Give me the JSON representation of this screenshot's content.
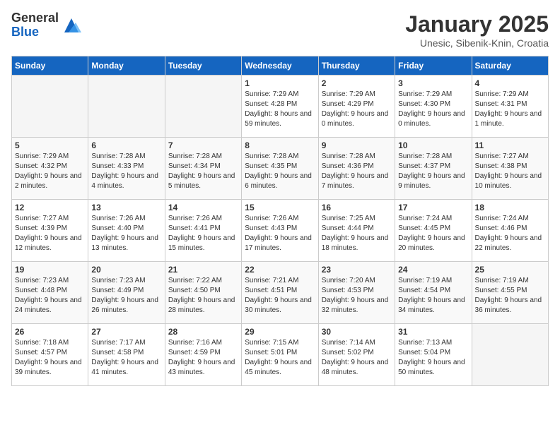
{
  "logo": {
    "general": "General",
    "blue": "Blue"
  },
  "title": {
    "month": "January 2025",
    "location": "Unesic, Sibenik-Knin, Croatia"
  },
  "weekdays": [
    "Sunday",
    "Monday",
    "Tuesday",
    "Wednesday",
    "Thursday",
    "Friday",
    "Saturday"
  ],
  "weeks": [
    [
      {
        "day": "",
        "content": ""
      },
      {
        "day": "",
        "content": ""
      },
      {
        "day": "",
        "content": ""
      },
      {
        "day": "1",
        "content": "Sunrise: 7:29 AM\nSunset: 4:28 PM\nDaylight: 8 hours and 59 minutes."
      },
      {
        "day": "2",
        "content": "Sunrise: 7:29 AM\nSunset: 4:29 PM\nDaylight: 9 hours and 0 minutes."
      },
      {
        "day": "3",
        "content": "Sunrise: 7:29 AM\nSunset: 4:30 PM\nDaylight: 9 hours and 0 minutes."
      },
      {
        "day": "4",
        "content": "Sunrise: 7:29 AM\nSunset: 4:31 PM\nDaylight: 9 hours and 1 minute."
      }
    ],
    [
      {
        "day": "5",
        "content": "Sunrise: 7:29 AM\nSunset: 4:32 PM\nDaylight: 9 hours and 2 minutes."
      },
      {
        "day": "6",
        "content": "Sunrise: 7:28 AM\nSunset: 4:33 PM\nDaylight: 9 hours and 4 minutes."
      },
      {
        "day": "7",
        "content": "Sunrise: 7:28 AM\nSunset: 4:34 PM\nDaylight: 9 hours and 5 minutes."
      },
      {
        "day": "8",
        "content": "Sunrise: 7:28 AM\nSunset: 4:35 PM\nDaylight: 9 hours and 6 minutes."
      },
      {
        "day": "9",
        "content": "Sunrise: 7:28 AM\nSunset: 4:36 PM\nDaylight: 9 hours and 7 minutes."
      },
      {
        "day": "10",
        "content": "Sunrise: 7:28 AM\nSunset: 4:37 PM\nDaylight: 9 hours and 9 minutes."
      },
      {
        "day": "11",
        "content": "Sunrise: 7:27 AM\nSunset: 4:38 PM\nDaylight: 9 hours and 10 minutes."
      }
    ],
    [
      {
        "day": "12",
        "content": "Sunrise: 7:27 AM\nSunset: 4:39 PM\nDaylight: 9 hours and 12 minutes."
      },
      {
        "day": "13",
        "content": "Sunrise: 7:26 AM\nSunset: 4:40 PM\nDaylight: 9 hours and 13 minutes."
      },
      {
        "day": "14",
        "content": "Sunrise: 7:26 AM\nSunset: 4:41 PM\nDaylight: 9 hours and 15 minutes."
      },
      {
        "day": "15",
        "content": "Sunrise: 7:26 AM\nSunset: 4:43 PM\nDaylight: 9 hours and 17 minutes."
      },
      {
        "day": "16",
        "content": "Sunrise: 7:25 AM\nSunset: 4:44 PM\nDaylight: 9 hours and 18 minutes."
      },
      {
        "day": "17",
        "content": "Sunrise: 7:24 AM\nSunset: 4:45 PM\nDaylight: 9 hours and 20 minutes."
      },
      {
        "day": "18",
        "content": "Sunrise: 7:24 AM\nSunset: 4:46 PM\nDaylight: 9 hours and 22 minutes."
      }
    ],
    [
      {
        "day": "19",
        "content": "Sunrise: 7:23 AM\nSunset: 4:48 PM\nDaylight: 9 hours and 24 minutes."
      },
      {
        "day": "20",
        "content": "Sunrise: 7:23 AM\nSunset: 4:49 PM\nDaylight: 9 hours and 26 minutes."
      },
      {
        "day": "21",
        "content": "Sunrise: 7:22 AM\nSunset: 4:50 PM\nDaylight: 9 hours and 28 minutes."
      },
      {
        "day": "22",
        "content": "Sunrise: 7:21 AM\nSunset: 4:51 PM\nDaylight: 9 hours and 30 minutes."
      },
      {
        "day": "23",
        "content": "Sunrise: 7:20 AM\nSunset: 4:53 PM\nDaylight: 9 hours and 32 minutes."
      },
      {
        "day": "24",
        "content": "Sunrise: 7:19 AM\nSunset: 4:54 PM\nDaylight: 9 hours and 34 minutes."
      },
      {
        "day": "25",
        "content": "Sunrise: 7:19 AM\nSunset: 4:55 PM\nDaylight: 9 hours and 36 minutes."
      }
    ],
    [
      {
        "day": "26",
        "content": "Sunrise: 7:18 AM\nSunset: 4:57 PM\nDaylight: 9 hours and 39 minutes."
      },
      {
        "day": "27",
        "content": "Sunrise: 7:17 AM\nSunset: 4:58 PM\nDaylight: 9 hours and 41 minutes."
      },
      {
        "day": "28",
        "content": "Sunrise: 7:16 AM\nSunset: 4:59 PM\nDaylight: 9 hours and 43 minutes."
      },
      {
        "day": "29",
        "content": "Sunrise: 7:15 AM\nSunset: 5:01 PM\nDaylight: 9 hours and 45 minutes."
      },
      {
        "day": "30",
        "content": "Sunrise: 7:14 AM\nSunset: 5:02 PM\nDaylight: 9 hours and 48 minutes."
      },
      {
        "day": "31",
        "content": "Sunrise: 7:13 AM\nSunset: 5:04 PM\nDaylight: 9 hours and 50 minutes."
      },
      {
        "day": "",
        "content": ""
      }
    ]
  ]
}
